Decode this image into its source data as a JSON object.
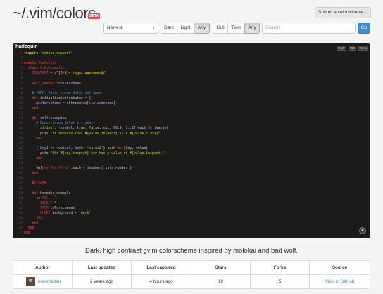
{
  "header": {
    "logo": "~/.vim/colors",
    "beta": "BETA",
    "submit_label": "Submit a colorscheme..."
  },
  "filters": {
    "sort_value": "Newest",
    "background_buttons": [
      "Dark",
      "Light",
      "Any"
    ],
    "background_active": "Any",
    "editor_buttons": [
      "GUI",
      "Term",
      "Any"
    ],
    "editor_active": "Any",
    "search_placeholder": "Search",
    "go_label": "Go"
  },
  "scheme": {
    "name": "harlequin",
    "mini_buttons": [
      "Dark",
      "GUI",
      "Term"
    ],
    "description": "Dark, high contrast gvim colorscheme inspired by molokai and bad wolf.",
    "code_lines": [
      "require 'active_support'",
      "",
      "module VimColors",
      "  class RubyExample",
      "    CONSTANT = /^[0-9]+ regex awesomes$/",
      "",
      "    attr_reader :colorscheme",
      "",
      "    # TODO: Bacon ipsum dolor sit amet",
      "    def initialize(attributes = {})",
      "      @colorscheme = attributes[:colorscheme]",
      "    end",
      "",
      "    def self.examples",
      "      # Bacon ipsum dolor sit amet",
      "      ['string', :symbol, true, false, nil, 99.9, 1..2].each do |value|",
      "        puts \"it appears that #{value.inspect} is a #{value.class}\"",
      "      end",
      "",
      "      {:key1 => :value1, key2: 'value2'}.each do |key, value|",
      "        puts \"the #{key.inspect} key has a value of #{value.inspect}\"",
      "      end",
      "",
      "      %w[One Two Three].each { |number| puts number }",
      "    end",
      "",
      "    private",
      "",
      "    def heredoc_example",
      "      <<-SQL",
      "        SELECT *",
      "        FROM colorschemes",
      "        WHERE background = 'dark'",
      "      SQL",
      "    end",
      "  end",
      "end"
    ]
  },
  "table": {
    "headers": [
      "Author",
      "Last updated",
      "Last captured",
      "Stars",
      "Forks",
      "Source"
    ],
    "author": "nielsmadan",
    "last_updated": "2 years ago",
    "last_captured": "4 hours ago",
    "stars": "19",
    "forks": "5",
    "source_link": "View in GitHub"
  },
  "colors": {
    "accent": "#428bca",
    "panel_bg": "#1c1b1a",
    "beta_red": "#d9534f"
  }
}
